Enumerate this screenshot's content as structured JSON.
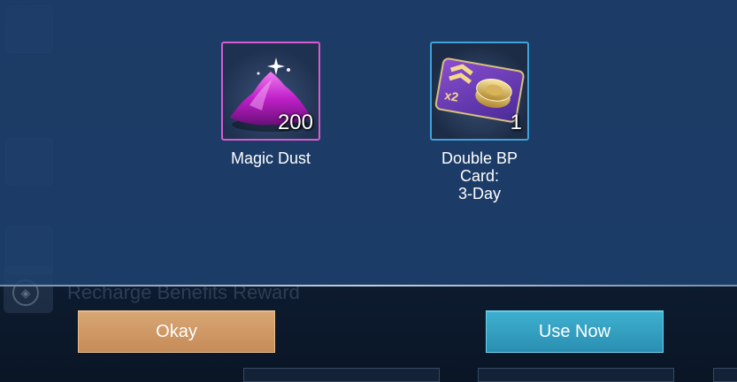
{
  "rewards": [
    {
      "name": "Magic Dust",
      "quantity": "200",
      "icon": "magic-dust-icon",
      "frame_color": "#d65ccf"
    },
    {
      "name": "Double BP Card: 3-Day",
      "name_line1": "Double BP Card:",
      "name_line2": "3-Day",
      "quantity": "1",
      "icon": "double-bp-card-icon",
      "frame_color": "#3fa2d8"
    }
  ],
  "background": {
    "recharge_title": "Recharge Benefits Reward"
  },
  "buttons": {
    "okay_label": "Okay",
    "use_now_label": "Use Now"
  },
  "colors": {
    "okay_button": "#c68b58",
    "use_now_button": "#2a8fb2",
    "panel": "#1d3e6c"
  }
}
